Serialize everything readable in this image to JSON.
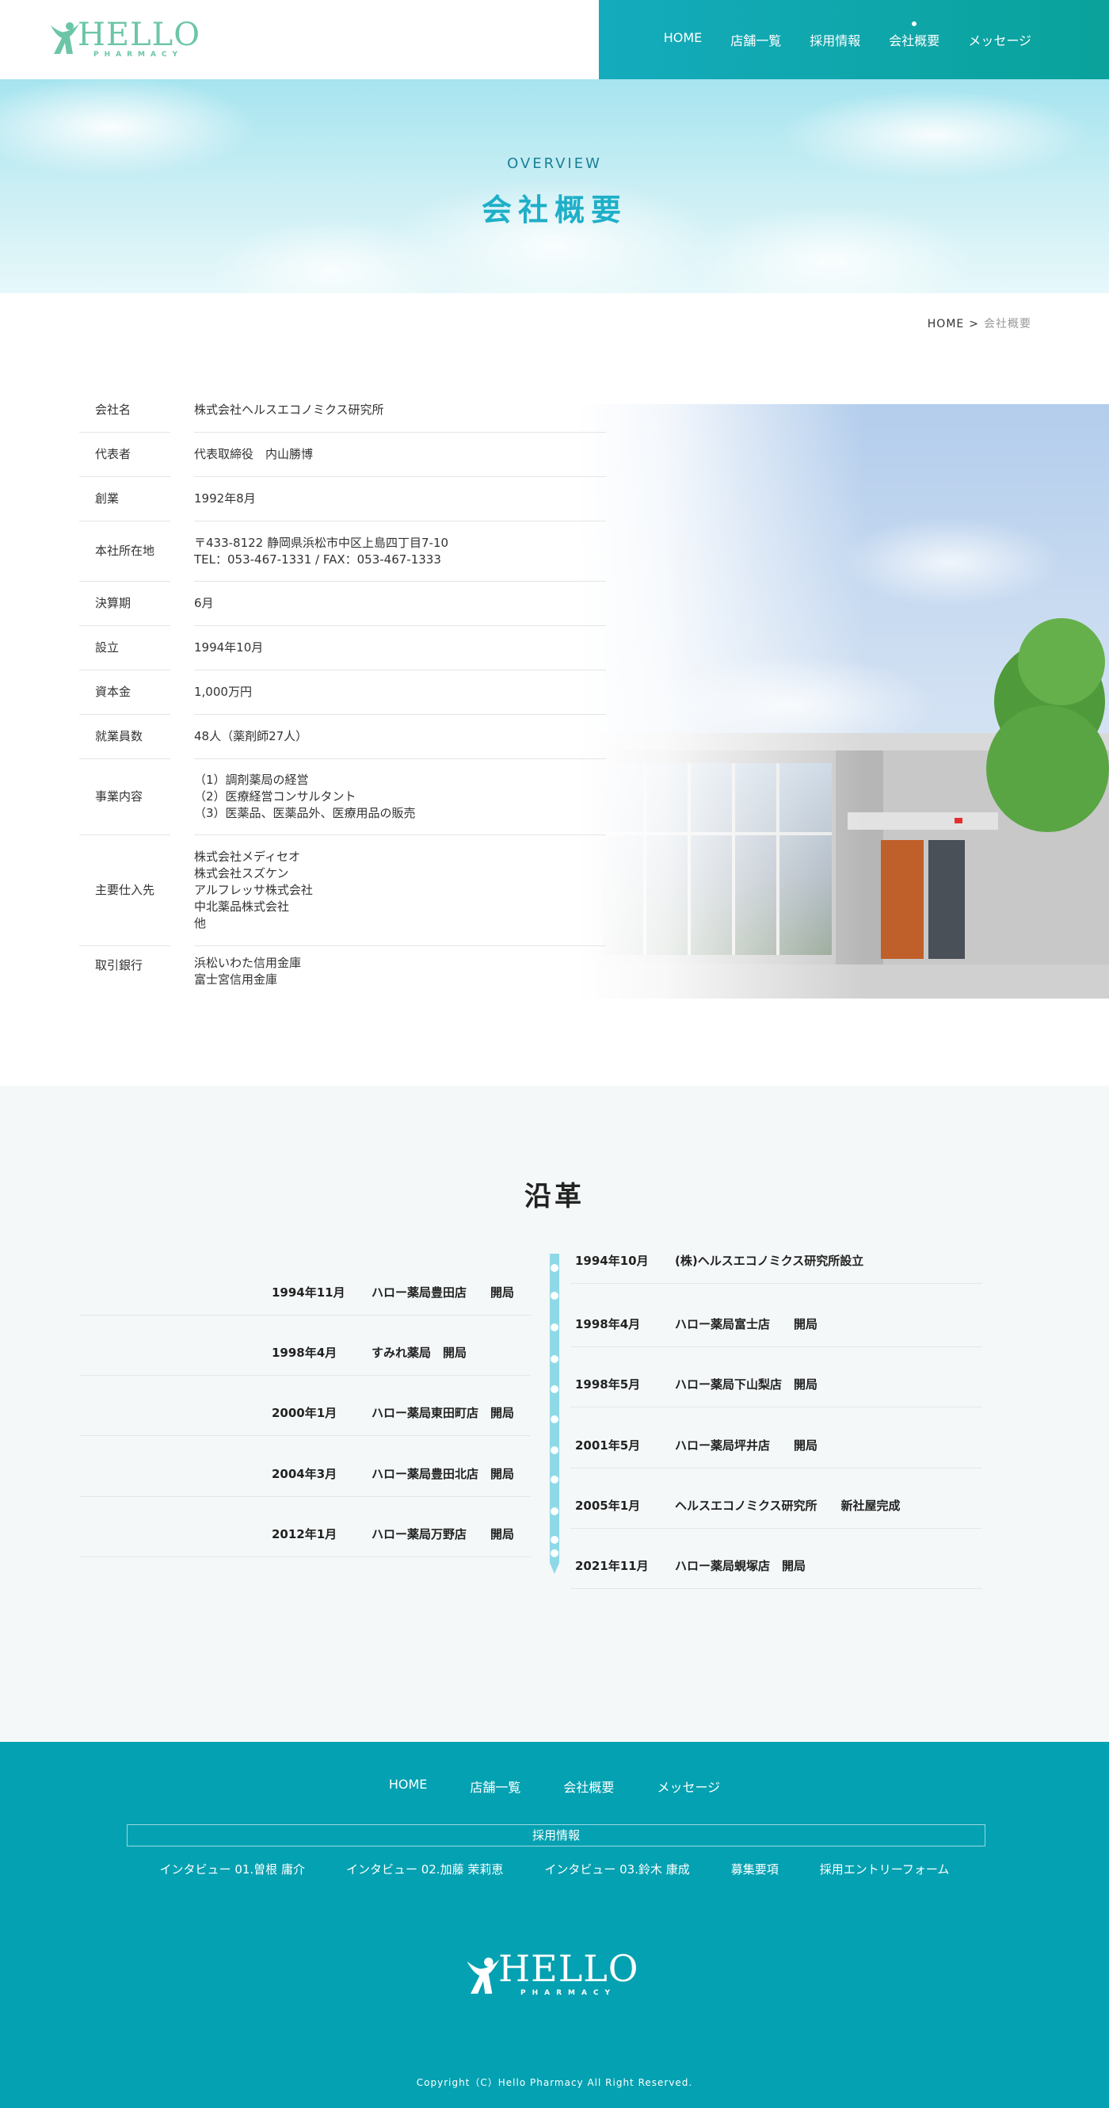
{
  "header": {
    "logo_text": "HELLO",
    "logo_sub": "PHARMACY",
    "nav": [
      {
        "label": "HOME"
      },
      {
        "label": "店舗一覧"
      },
      {
        "label": "採用情報"
      },
      {
        "label": "会社概要",
        "active": true
      },
      {
        "label": "メッセージ"
      }
    ],
    "nav_gradient": [
      "#14abbd",
      "#0aa29a"
    ]
  },
  "hero": {
    "subtitle": "OVERVIEW",
    "title": "会社概要"
  },
  "breadcrumb": {
    "home": "HOME",
    "separator": ">",
    "current": "会社概要"
  },
  "overview": {
    "rows": [
      {
        "label": "会社名",
        "lines": [
          "株式会社ヘルスエコノミクス研究所"
        ]
      },
      {
        "label": "代表者",
        "lines": [
          "代表取締役　内山勝博"
        ]
      },
      {
        "label": "創業",
        "lines": [
          "1992年8月"
        ]
      },
      {
        "label": "本社所在地",
        "lines": [
          "〒433-8122 静岡県浜松市中区上島四丁目7-10",
          "TEL：053-467-1331 / FAX：053-467-1333"
        ]
      },
      {
        "label": "決算期",
        "lines": [
          "6月"
        ]
      },
      {
        "label": "設立",
        "lines": [
          "1994年10月"
        ]
      },
      {
        "label": "資本金",
        "lines": [
          "1,000万円"
        ]
      },
      {
        "label": "就業員数",
        "lines": [
          "48人（薬剤師27人）"
        ]
      },
      {
        "label": "事業内容",
        "lines": [
          "（1）調剤薬局の経営",
          "（2）医療経営コンサルタント",
          "（3）医薬品、医薬品外、医療用品の販売"
        ]
      },
      {
        "label": "主要仕入先",
        "lines": [
          "株式会社メディセオ",
          "株式会社スズケン",
          "アルフレッサ株式会社",
          "中北薬品株式会社",
          "他"
        ]
      },
      {
        "label": "取引銀行",
        "lines": [
          "浜松いわた信用金庫",
          "富士宮信用金庫"
        ]
      }
    ]
  },
  "history": {
    "title": "沿革",
    "left": [
      {
        "date": "1994年11月",
        "event": "ハロー薬局豊田店　　開局"
      },
      {
        "date": "1998年4月",
        "event": "すみれ薬局　開局"
      },
      {
        "date": "2000年1月",
        "event": "ハロー薬局東田町店　開局"
      },
      {
        "date": "2004年3月",
        "event": "ハロー薬局豊田北店　開局"
      },
      {
        "date": "2012年1月",
        "event": "ハロー薬局万野店　　開局"
      }
    ],
    "right": [
      {
        "date": "1994年10月",
        "event": "(株)ヘルスエコノミクス研究所設立"
      },
      {
        "date": "1998年4月",
        "event": "ハロー薬局富士店　　開局"
      },
      {
        "date": "1998年5月",
        "event": "ハロー薬局下山梨店　開局"
      },
      {
        "date": "2001年5月",
        "event": "ハロー薬局坪井店　　開局"
      },
      {
        "date": "2005年1月",
        "event": "ヘルスエコノミクス研究所　　新社屋完成"
      },
      {
        "date": "2021年11月",
        "event": "ハロー薬局蜆塚店　開局"
      }
    ],
    "line_color": "#8ed9e7"
  },
  "footer": {
    "nav": [
      "HOME",
      "店舗一覧",
      "会社概要",
      "メッセージ"
    ],
    "recruit_label": "採用情報",
    "recruit_links": [
      "インタビュー 01.曽根 庸介",
      "インタビュー 02.加藤 茉莉恵",
      "インタビュー 03.鈴木 康成",
      "募集要項",
      "採用エントリーフォーム"
    ],
    "logo_text": "HELLO",
    "logo_sub": "PHARMACY",
    "copyright": "Copyright（C）Hello Pharmacy All Right Reserved.",
    "background": "#03a1b2"
  }
}
